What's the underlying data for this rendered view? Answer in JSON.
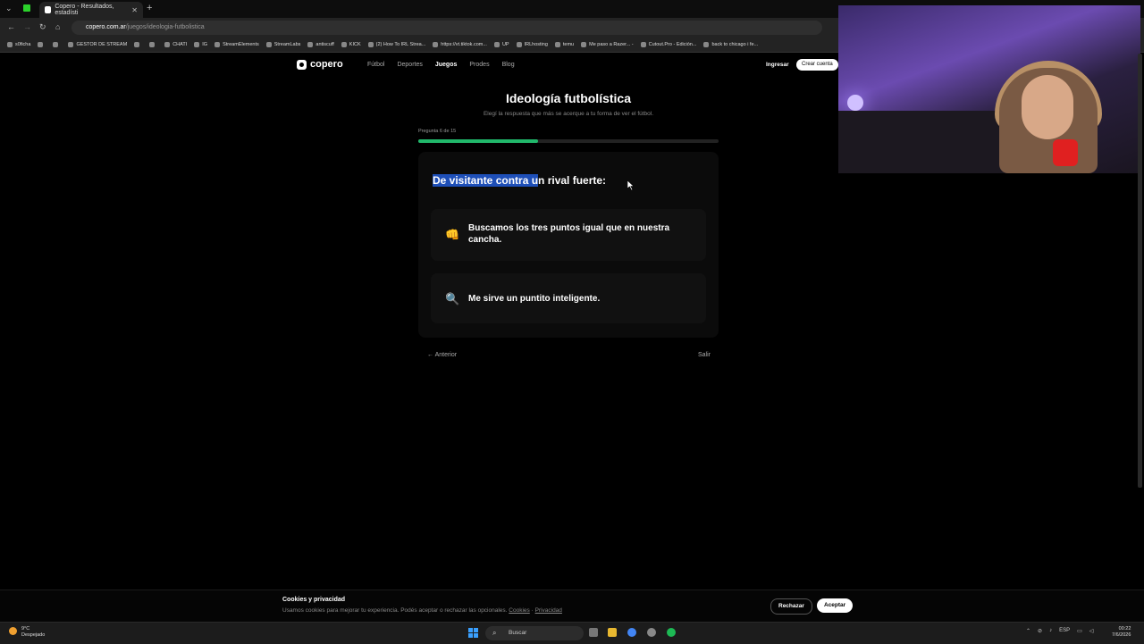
{
  "browser": {
    "tab_title": "Copero - Resultados, estadísti",
    "url_host": "copero.com.ar",
    "url_path": "/juegos/ideologia-futbolistica",
    "bookmarks": [
      "s0ficha",
      "",
      "",
      "GESTOR DE STREAM",
      "",
      "",
      "CHATI",
      "IG",
      "StreamElements",
      "StreamLabs",
      "antiscuff",
      "KICK",
      "(2) How To IRL Strea...",
      "https://vt.tiktok.com...",
      "UP",
      "IRLhosting",
      "temu",
      "Me paso a Razer... -",
      "Cutout.Pro - Edición...",
      "back to chicago i fe..."
    ]
  },
  "site": {
    "logo_text": "copero",
    "nav": [
      "Fútbol",
      "Deportes",
      "Juegos",
      "Prodes",
      "Blog"
    ],
    "login_label": "Ingresar",
    "signup_label": "Crear cuenta"
  },
  "quiz": {
    "title": "Ideología futbolística",
    "subtitle": "Elegí la respuesta que más se acerque a tu forma de ver el fútbol.",
    "progress_label": "Pregunta 6 de 15",
    "progress_fraction": 0.4,
    "question_highlighted": "De visitante contra u",
    "question_rest": "n rival fuerte:",
    "options": [
      {
        "emoji": "👊",
        "text": "Buscamos los tres puntos igual que en nuestra cancha."
      },
      {
        "emoji": "🔍",
        "text": "Me sirve un puntito inteligente."
      }
    ],
    "prev_label": "Anterior",
    "exit_label": "Salir"
  },
  "cookies": {
    "title": "Cookies y privacidad",
    "text": "Usamos cookies para mejorar tu experiencia. Podés aceptar o rechazar las opcionales.",
    "link_cookies": "Cookies",
    "separator": "·",
    "link_privacy": "Privacidad",
    "reject_label": "Rechazar",
    "accept_label": "Aceptar"
  },
  "taskbar": {
    "weather_temp": "9°C",
    "weather_desc": "Despejado",
    "search_placeholder": "Buscar",
    "lang": "ESP",
    "time": "00:22",
    "date": "7/6/2026"
  },
  "colors": {
    "accent_green": "#21b86b",
    "highlight_blue": "#1e4fb8"
  }
}
